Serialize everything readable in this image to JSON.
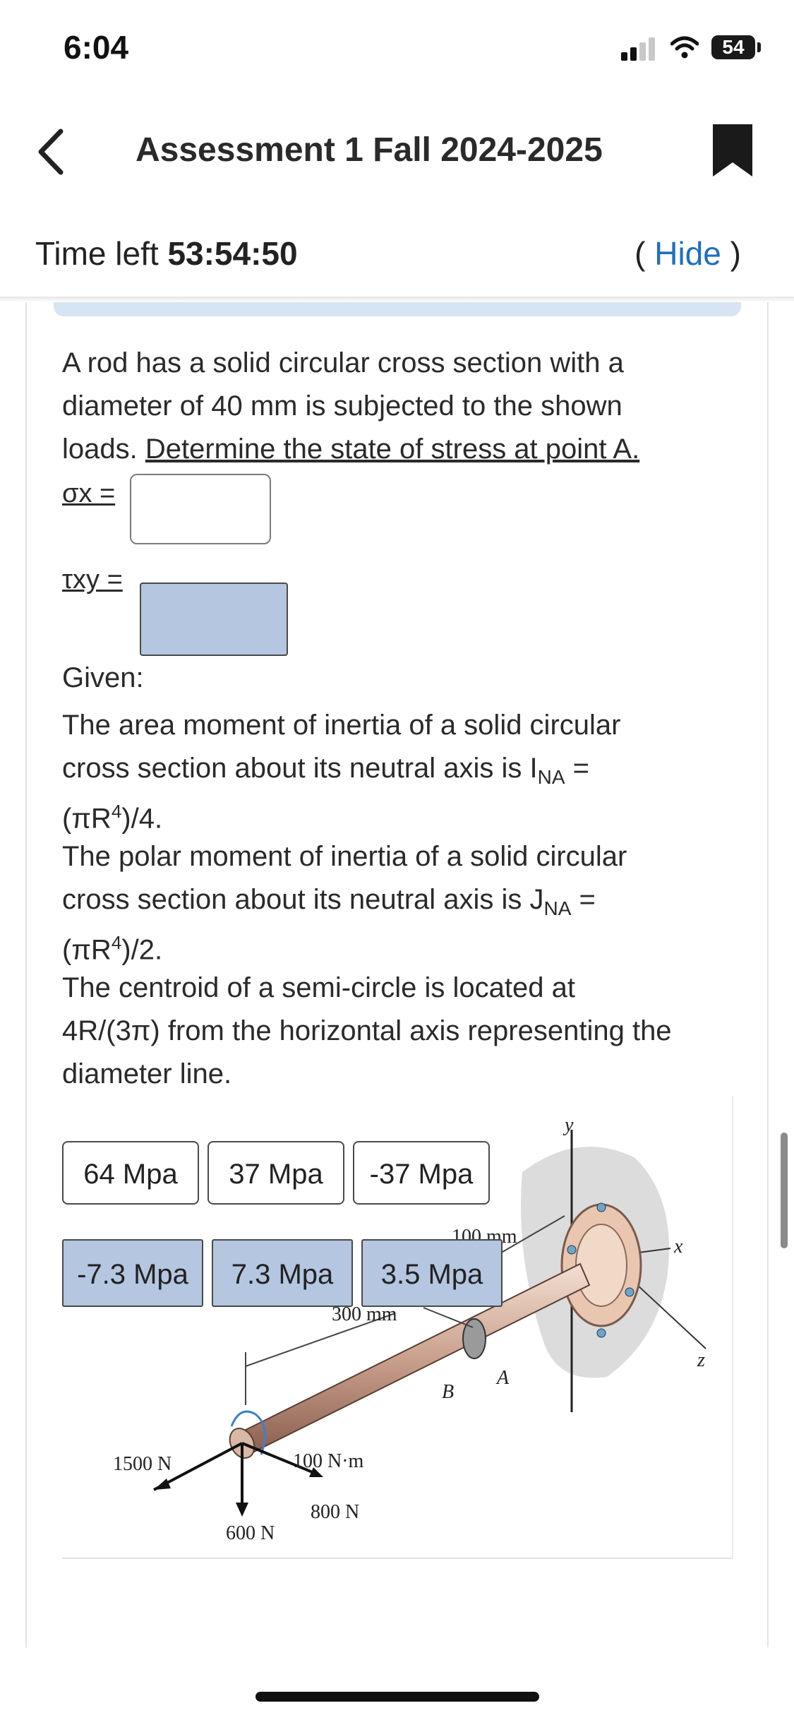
{
  "status_bar": {
    "time": "6:04",
    "battery": "54"
  },
  "nav": {
    "title": "Assessment 1 Fall 2024-2025",
    "back_icon": "chevron-left-icon",
    "bookmark_icon": "bookmark-icon"
  },
  "timer": {
    "label": "Time left",
    "value": "53:54:50",
    "hide_open": "(",
    "hide_link": "Hide",
    "hide_close": ")"
  },
  "question": {
    "line1": "A rod has a solid circular cross section with a",
    "line2": "diameter of 40 mm is subjected to the shown",
    "line3_plain": "loads. ",
    "line3_underlined": "Determine the state of stress at point A.",
    "sigma_label": "σx =",
    "tau_label": "τxy =",
    "given_title": "Given:",
    "given_1a": "The area moment of inertia of a solid circular",
    "given_1b": "cross section about its neutral axis is I",
    "given_1b_sub": "NA",
    "given_1b_end": " =",
    "given_1c_pre": "(πR",
    "given_1c_sup": "4",
    "given_1c_post": ")/4.",
    "given_2a": "The polar moment of inertia of a solid circular",
    "given_2b": "cross section about its neutral axis is J",
    "given_2b_sub": "NA",
    "given_2b_end": " =",
    "given_2c_pre": "(πR",
    "given_2c_sup": "4",
    "given_2c_post": ")/2.",
    "given_3a": "The centroid of a semi-circle is located at",
    "given_3b": "4R/(3π) from the horizontal axis representing the",
    "given_3c": "diameter line."
  },
  "choices": [
    {
      "label": "64 Mpa",
      "used": false
    },
    {
      "label": "37 Mpa",
      "used": false
    },
    {
      "label": "-37 Mpa",
      "used": false
    },
    {
      "label": "-7.3 Mpa",
      "used": true
    },
    {
      "label": "7.3 Mpa",
      "used": true
    },
    {
      "label": "3.5 Mpa",
      "used": true
    }
  ],
  "figure": {
    "label_100mm": "100 mm",
    "label_300mm": "300 mm",
    "label_1500N": "1500 N",
    "label_100Nm": "100 N·m",
    "label_800N": "800 N",
    "label_600N": "600 N",
    "label_A": "A",
    "label_B": "B",
    "label_x": "x",
    "label_y": "y",
    "label_z": "z"
  },
  "colors": {
    "link": "#1f6fbf",
    "drop_fill": "#b4c6e0",
    "strip": "#d6e4f3"
  }
}
